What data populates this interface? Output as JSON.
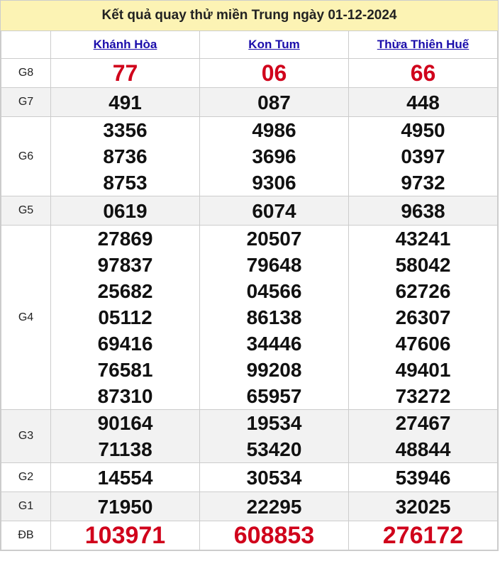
{
  "title": "Kết quả quay thử miền Trung ngày 01-12-2024",
  "provinces": [
    "Khánh Hòa",
    "Kon Tum",
    "Thừa Thiên Huế"
  ],
  "rows": [
    {
      "label": "G8",
      "values": [
        [
          "77"
        ],
        [
          "06"
        ],
        [
          "66"
        ]
      ]
    },
    {
      "label": "G7",
      "values": [
        [
          "491"
        ],
        [
          "087"
        ],
        [
          "448"
        ]
      ]
    },
    {
      "label": "G6",
      "values": [
        [
          "3356",
          "8736",
          "8753"
        ],
        [
          "4986",
          "3696",
          "9306"
        ],
        [
          "4950",
          "0397",
          "9732"
        ]
      ]
    },
    {
      "label": "G5",
      "values": [
        [
          "0619"
        ],
        [
          "6074"
        ],
        [
          "9638"
        ]
      ]
    },
    {
      "label": "G4",
      "values": [
        [
          "27869",
          "97837",
          "25682",
          "05112",
          "69416",
          "76581",
          "87310"
        ],
        [
          "20507",
          "79648",
          "04566",
          "86138",
          "34446",
          "99208",
          "65957"
        ],
        [
          "43241",
          "58042",
          "62726",
          "26307",
          "47606",
          "49401",
          "73272"
        ]
      ]
    },
    {
      "label": "G3",
      "values": [
        [
          "90164",
          "71138"
        ],
        [
          "19534",
          "53420"
        ],
        [
          "27467",
          "48844"
        ]
      ]
    },
    {
      "label": "G2",
      "values": [
        [
          "14554"
        ],
        [
          "30534"
        ],
        [
          "53946"
        ]
      ]
    },
    {
      "label": "G1",
      "values": [
        [
          "71950"
        ],
        [
          "22295"
        ],
        [
          "32025"
        ]
      ]
    },
    {
      "label": "ĐB",
      "values": [
        [
          "103971"
        ],
        [
          "608853"
        ],
        [
          "276172"
        ]
      ]
    }
  ],
  "colors": {
    "header_bg": "#fcf3b4",
    "link": "#1a0dab",
    "highlight": "#d0021b",
    "shade": "#f2f2f2"
  }
}
